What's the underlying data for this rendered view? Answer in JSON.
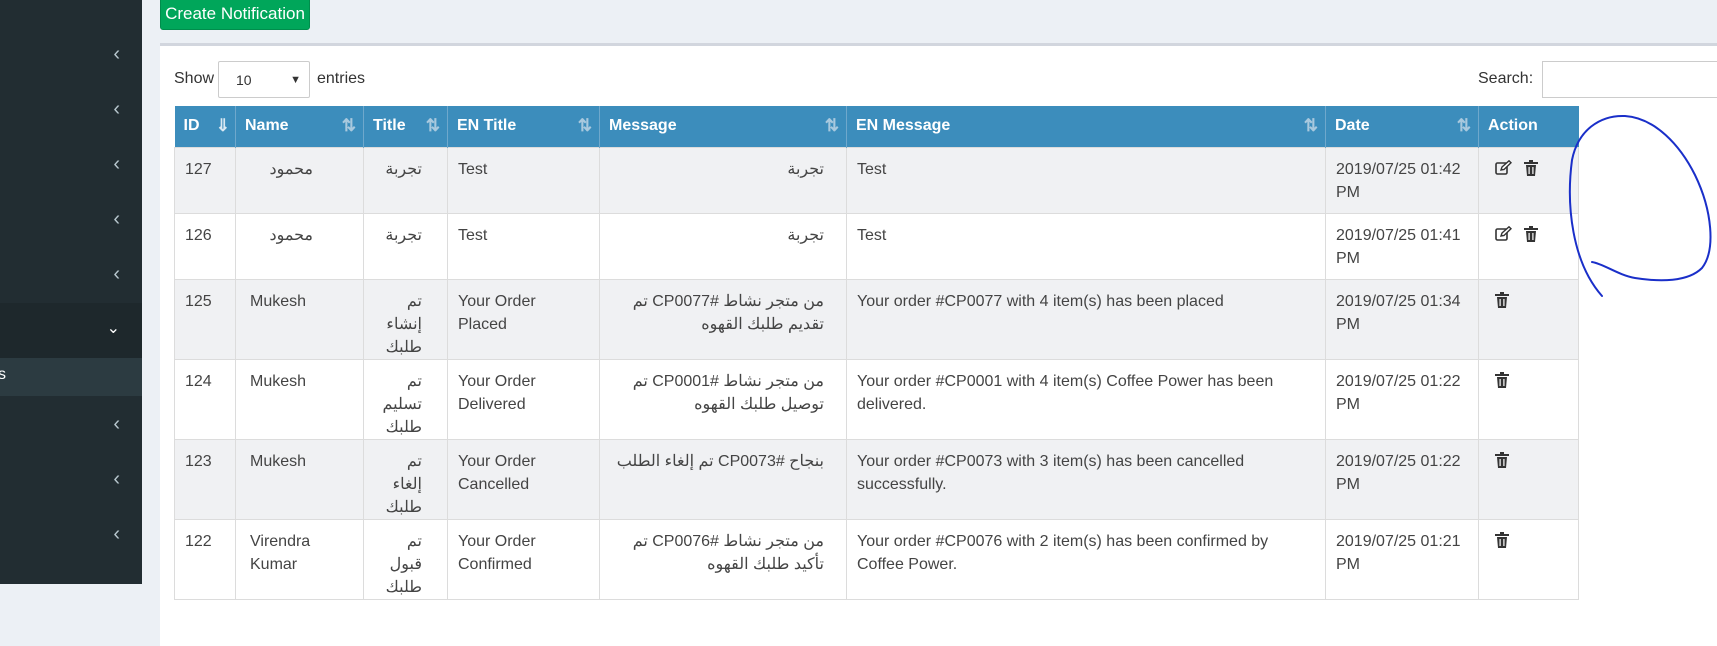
{
  "sidebar": {
    "chevrons": [
      "‹",
      "‹",
      "‹",
      "‹",
      "‹"
    ],
    "open_chevron": "⌄",
    "sub_item_label": "s",
    "more_chevrons": [
      "‹",
      "‹",
      "‹"
    ]
  },
  "toolbar": {
    "create_label": "Create Notification"
  },
  "controls": {
    "show_label": "Show",
    "length_value": "10",
    "entries_label": "entries",
    "search_label": "Search:",
    "search_value": ""
  },
  "table": {
    "columns": [
      "ID",
      "Name",
      "Title",
      "EN Title",
      "Message",
      "EN Message",
      "Date",
      "Action"
    ],
    "rows": [
      {
        "id": "127",
        "name": "محمود",
        "title": "تجربة",
        "en_title": "Test",
        "message": "تجربة",
        "en_message": "Test",
        "date": "2019/07/25 01:42 PM",
        "actions": [
          "edit-icon",
          "trash-icon"
        ]
      },
      {
        "id": "126",
        "name": "محمود",
        "title": "تجربة",
        "en_title": "Test",
        "message": "تجربة",
        "en_message": "Test",
        "date": "2019/07/25 01:41 PM",
        "actions": [
          "edit-icon",
          "trash-icon"
        ]
      },
      {
        "id": "125",
        "name": "Mukesh",
        "title": "تم إنشاء طلبك",
        "en_title": "Your Order Placed",
        "message": "من متجر نشاط CP0077# تم تقديم طلبك القهوه",
        "en_message": "Your order #CP0077 with 4 item(s) has been placed",
        "date": "2019/07/25 01:34 PM",
        "actions": [
          "trash-icon"
        ]
      },
      {
        "id": "124",
        "name": "Mukesh",
        "title": "تم تسليم طلبك",
        "en_title": "Your Order Delivered",
        "message": "من متجر نشاط CP0001# تم توصيل طلبك القهوه",
        "en_message": "Your order #CP0001 with 4 item(s) Coffee Power has been delivered.",
        "date": "2019/07/25 01:22 PM",
        "actions": [
          "trash-icon"
        ]
      },
      {
        "id": "123",
        "name": "Mukesh",
        "title": "تم إلغاء طلبك",
        "en_title": "Your Order Cancelled",
        "message": "بنجاح CP0073# تم إلغاء الطلب",
        "en_message": "Your order #CP0073 with 3 item(s) has been cancelled successfully.",
        "date": "2019/07/25 01:22 PM",
        "actions": [
          "trash-icon"
        ]
      },
      {
        "id": "122",
        "name": "Virendra Kumar",
        "title": "تم قبول طلبك",
        "en_title": "Your Order Confirmed",
        "message": "من متجر نشاط CP0076# تم تأكيد طلبك القهوه",
        "en_message": "Your order #CP0076 with 2 item(s) has been confirmed by Coffee Power.",
        "date": "2019/07/25 01:21 PM",
        "actions": [
          "trash-icon"
        ]
      }
    ]
  },
  "colors": {
    "sidebar_bg": "#222d32",
    "header_bg": "#3c8dbc",
    "create_button": "#00a65a",
    "annotation": "#1a2fc9"
  }
}
